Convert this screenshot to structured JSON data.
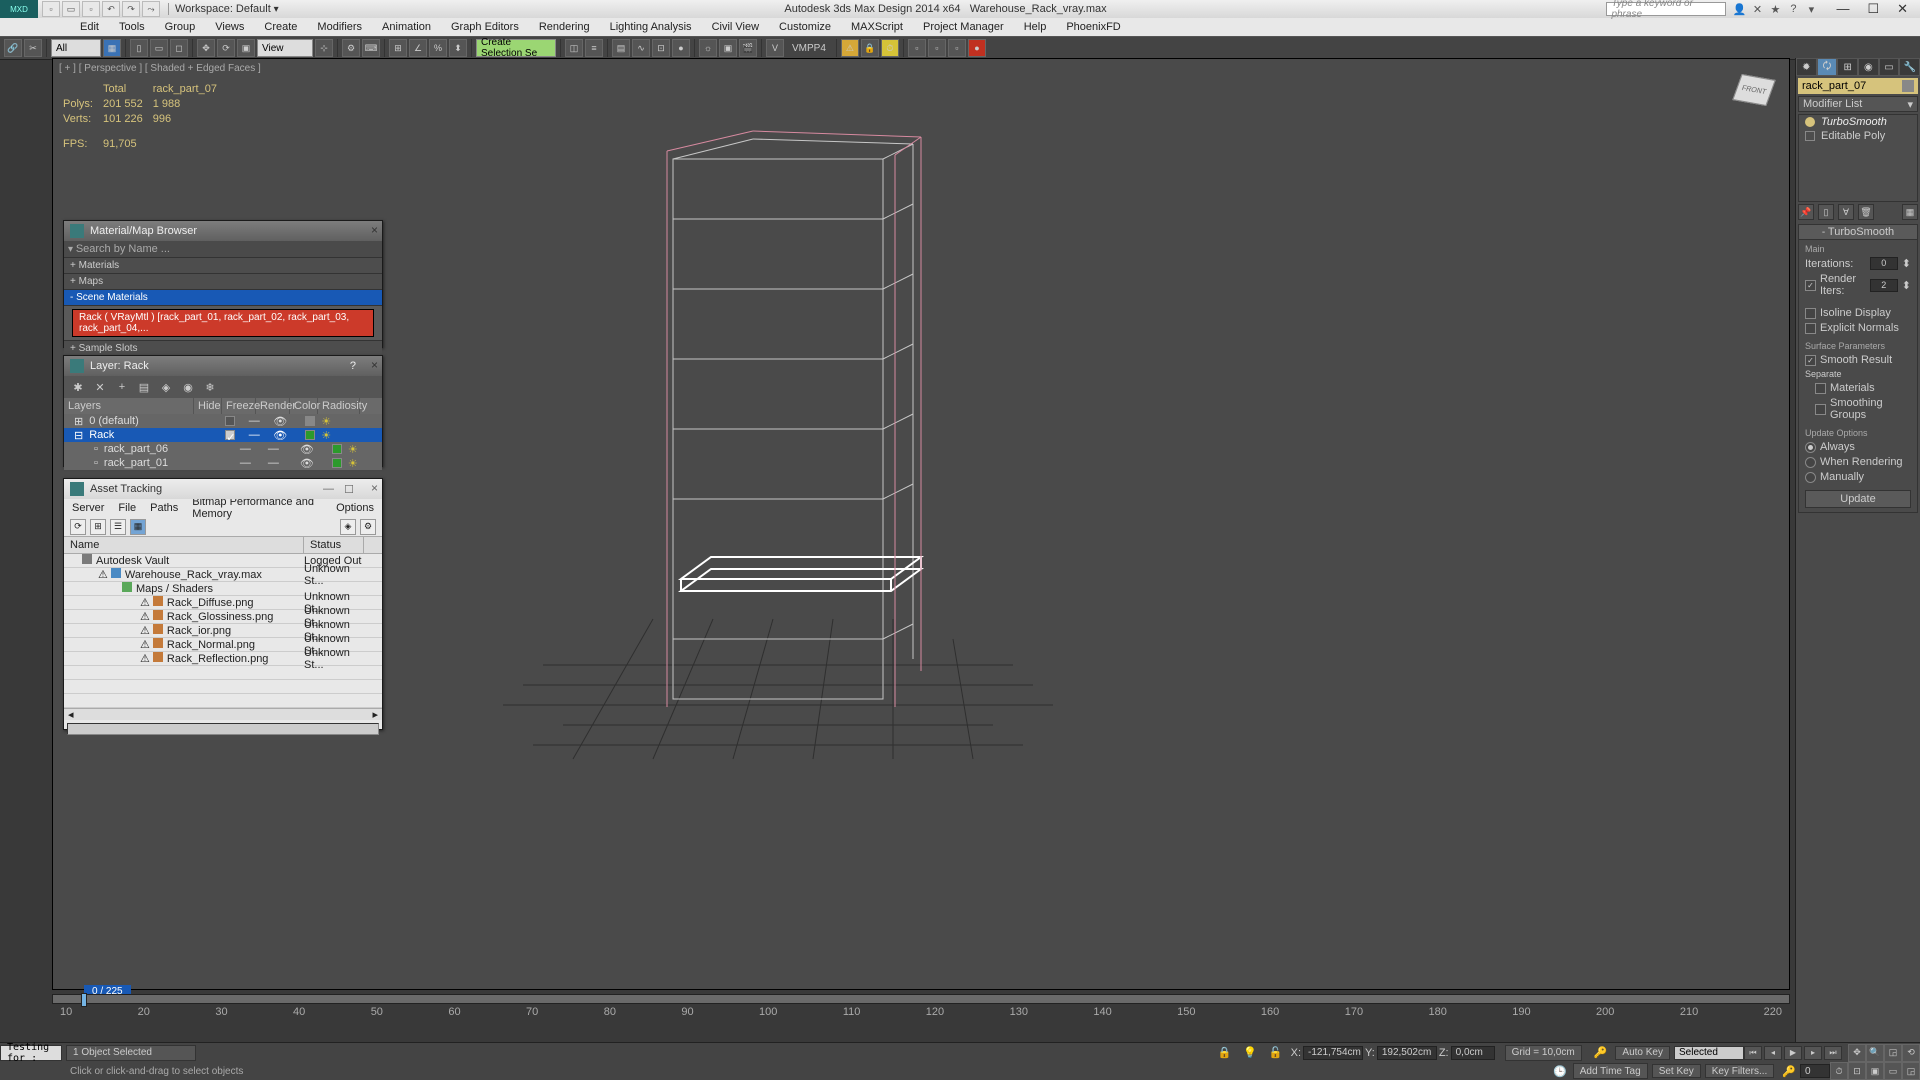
{
  "title": {
    "app": "Autodesk 3ds Max Design 2014 x64",
    "file": "Warehouse_Rack_vray.max",
    "workspace": "Workspace: Default",
    "search_ph": "Type a keyword or phrase"
  },
  "menu": [
    "Edit",
    "Tools",
    "Group",
    "Views",
    "Create",
    "Modifiers",
    "Animation",
    "Graph Editors",
    "Rendering",
    "Lighting Analysis",
    "Civil View",
    "Customize",
    "MAXScript",
    "Project Manager",
    "Help",
    "PhoenixFD"
  ],
  "toolbar": {
    "all": "All",
    "view": "View",
    "sel_set": "Create Selection Se",
    "vray_label": "VMPP4"
  },
  "viewport": {
    "label": "[ + ] [ Perspective ] [ Shaded + Edged Faces ]",
    "stats": {
      "col1": "Total",
      "col2": "rack_part_07",
      "polys": "Polys:",
      "poly_total": "201 552",
      "poly_sel": "1 988",
      "verts": "Verts:",
      "vert_total": "101 226",
      "vert_sel": "996",
      "fps": "FPS:",
      "fps_val": "91,705"
    }
  },
  "mat_browser": {
    "title": "Material/Map Browser",
    "search": "Search by Name ...",
    "sections": [
      "+ Materials",
      "+ Maps",
      "- Scene Materials"
    ],
    "item": "Rack  ( VRayMtl )  [rack_part_01, rack_part_02, rack_part_03, rack_part_04,...",
    "slots": "+ Sample Slots"
  },
  "layer": {
    "title": "Layer: Rack",
    "cols": [
      "Layers",
      "Hide",
      "Freeze",
      "Render",
      "Color",
      "Radiosity"
    ],
    "rows": [
      {
        "name": "0 (default)",
        "sel": false,
        "indent": 0
      },
      {
        "name": "Rack",
        "sel": true,
        "indent": 0
      },
      {
        "name": "rack_part_06",
        "sel": false,
        "indent": 1
      },
      {
        "name": "rack_part_01",
        "sel": false,
        "indent": 1
      }
    ]
  },
  "asset": {
    "title": "Asset Tracking",
    "menu": [
      "Server",
      "File",
      "Paths",
      "Bitmap Performance and Memory",
      "Options"
    ],
    "cols": [
      "Name",
      "Status"
    ],
    "rows": [
      {
        "name": "Autodesk Vault",
        "status": "Logged Out",
        "indent": 0
      },
      {
        "name": "Warehouse_Rack_vray.max",
        "status": "Unknown St...",
        "indent": 1
      },
      {
        "name": "Maps / Shaders",
        "status": "",
        "indent": 2
      },
      {
        "name": "Rack_Diffuse.png",
        "status": "Unknown St...",
        "indent": 3
      },
      {
        "name": "Rack_Glossiness.png",
        "status": "Unknown St...",
        "indent": 3
      },
      {
        "name": "Rack_ior.png",
        "status": "Unknown St...",
        "indent": 3
      },
      {
        "name": "Rack_Normal.png",
        "status": "Unknown St...",
        "indent": 3
      },
      {
        "name": "Rack_Reflection.png",
        "status": "Unknown St...",
        "indent": 3
      }
    ]
  },
  "cmd": {
    "name": "rack_part_07",
    "modlist": "Modifier List",
    "stack": [
      {
        "label": "TurboSmooth",
        "active": true
      },
      {
        "label": "Editable Poly",
        "active": false
      }
    ],
    "rollout": {
      "title": "TurboSmooth",
      "main": "Main",
      "iter_lbl": "Iterations:",
      "iter_val": "0",
      "rend_lbl": "Render Iters:",
      "rend_val": "2",
      "iso": "Isoline Display",
      "exp": "Explicit Normals",
      "surf": "Surface Parameters",
      "smooth": "Smooth Result",
      "sep": "Separate",
      "mats": "Materials",
      "sg": "Smoothing Groups",
      "upd": "Update Options",
      "always": "Always",
      "when": "When Rendering",
      "man": "Manually",
      "btn": "Update"
    }
  },
  "timeline": {
    "frame": "0 / 225",
    "ticks": [
      "10",
      "20",
      "30",
      "40",
      "50",
      "60",
      "70",
      "80",
      "90",
      "100",
      "110",
      "120",
      "130",
      "140",
      "150",
      "160",
      "170",
      "180",
      "190",
      "200",
      "210",
      "220"
    ]
  },
  "status": {
    "sel": "1 Object Selected",
    "x": "-121,754cm",
    "y": "192,502cm",
    "z": "0,0cm",
    "grid": "Grid = 10,0cm",
    "autokey": "Auto Key",
    "setkey": "Set Key",
    "selected": "Selected",
    "keyfilt": "Key Filters...",
    "addtag": "Add Time Tag",
    "testing": "Testing for :",
    "prompt": "Click or click-and-drag to select objects",
    "frame_field": "0"
  }
}
